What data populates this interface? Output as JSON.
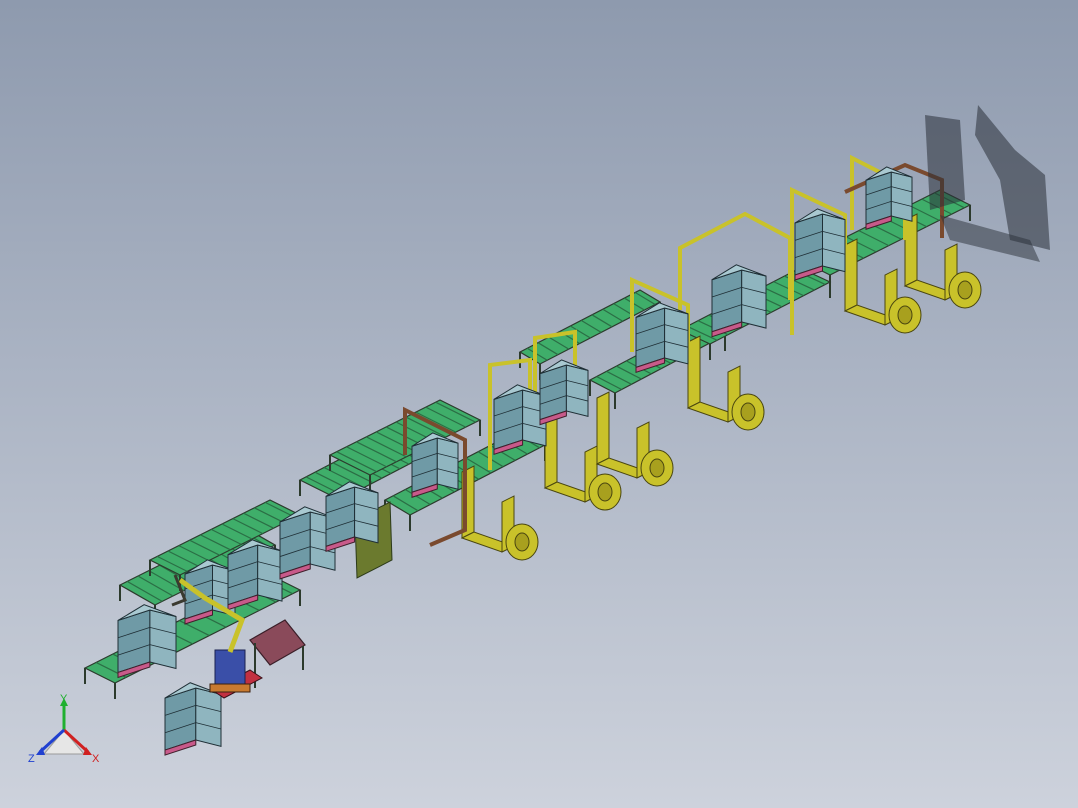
{
  "viewport": {
    "background_top": "#8e9aae",
    "background_bottom": "#cdd2dc"
  },
  "colors": {
    "conveyor_green": "#3fae6a",
    "conveyor_frame": "#2c3a2c",
    "frame_yellow": "#c9c22a",
    "frame_brown": "#7a4a2e",
    "pallet_load": "#7fa6b2",
    "pallet_pink": "#c85a8a",
    "robot_blue": "#3a4fa8",
    "table_maroon": "#8a4a5a"
  },
  "triad": {
    "x_label": "X",
    "y_label": "Y",
    "z_label": "Z",
    "x_color": "#d02020",
    "y_color": "#20b030",
    "z_color": "#2040d0"
  }
}
